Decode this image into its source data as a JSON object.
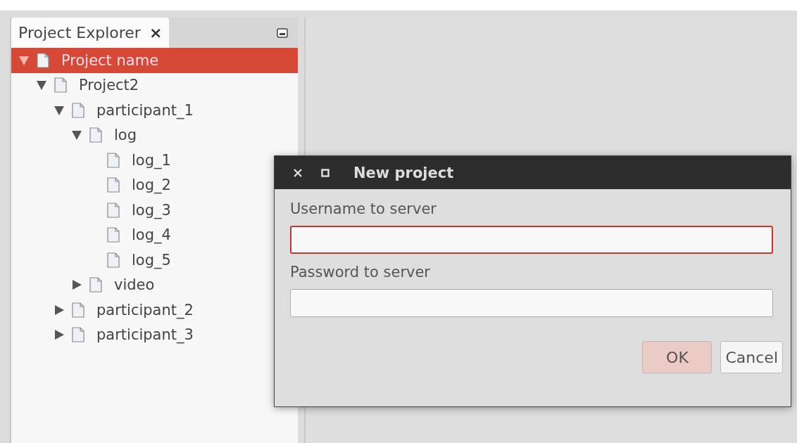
{
  "explorer": {
    "tab": {
      "label": "Project Explorer",
      "close": "×"
    },
    "tree": [
      {
        "label": "Project name",
        "selected": true,
        "expanded": true,
        "children": [
          {
            "label": "Project2",
            "selected": false,
            "expanded": true,
            "children": [
              {
                "label": "participant_1",
                "selected": false,
                "expanded": true,
                "children": [
                  {
                    "label": "log",
                    "selected": false,
                    "expanded": true,
                    "children": [
                      {
                        "label": "log_1",
                        "selected": false
                      },
                      {
                        "label": "log_2",
                        "selected": false
                      },
                      {
                        "label": "log_3",
                        "selected": false
                      },
                      {
                        "label": "log_4",
                        "selected": false
                      },
                      {
                        "label": "log_5",
                        "selected": false
                      }
                    ]
                  },
                  {
                    "label": "video",
                    "selected": false,
                    "expanded": false
                  }
                ]
              },
              {
                "label": "participant_2",
                "selected": false,
                "expanded": false
              },
              {
                "label": "participant_3",
                "selected": false,
                "expanded": false
              }
            ]
          }
        ]
      }
    ]
  },
  "dialog": {
    "title": "New project",
    "fields": [
      {
        "label": "Username to server",
        "focused": true
      },
      {
        "label": "Password to server",
        "focused": false
      }
    ],
    "buttons": [
      {
        "label": "OK",
        "kind": "default"
      },
      {
        "label": "Cancel",
        "kind": "normal"
      }
    ]
  }
}
